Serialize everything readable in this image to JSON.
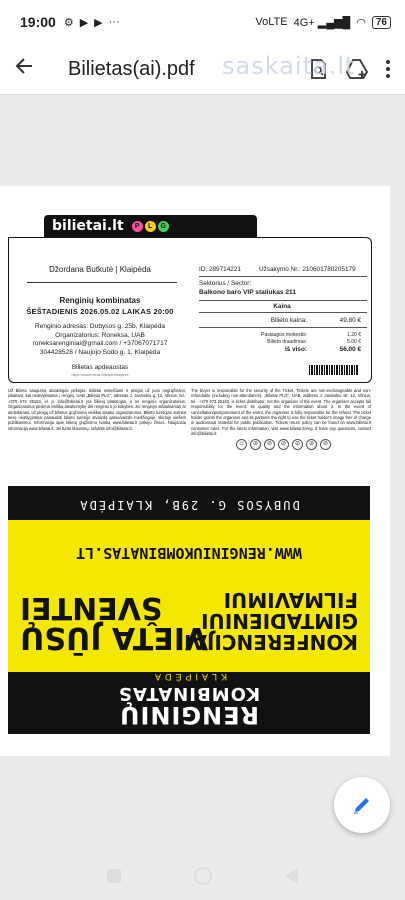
{
  "status_bar": {
    "time": "19:00",
    "battery": "76",
    "network": "4G+",
    "volte": "VoLTE"
  },
  "app_bar": {
    "title": "Bilietas(ai).pdf",
    "watermark": "saskaita.lt"
  },
  "ticket": {
    "logo": "bilietai.lt",
    "plg_letters": [
      "P",
      "L",
      "G"
    ],
    "organizer": "Džordana Butkutė | Klaipėda",
    "event": "Renginių kombinatas",
    "date_line": "ŠEŠTADIENIS 2026.05.02   LAIKAS 20:00",
    "address_lines": [
      "Renginio adresas: Dubysos g. 25b, Klaipėda",
      "Organizatorius: Roneksa, UAB",
      "roneksarenginiai@gmail.com / +37067071717",
      "304428528 / Naujojo Sodo g. 1, Klaipėda"
    ],
    "docs_title": "Bilietas apdeaustas",
    "docs_link": "https://www.bilietai.lt/lit/apie/taisykles",
    "id_line": "ID: 289714221",
    "order_line": "Užsakymo Nr.: 210601780205179",
    "sector_label": "Sektorius / Sector:",
    "seat": "Balkono baro VIP staliukas 211",
    "price_header": "Kaina",
    "rows": [
      {
        "k": "Bilieto kaina:",
        "v": "49.80 €"
      },
      {
        "k": "Paslaugos mokestis:",
        "v": "1.20 €"
      },
      {
        "k": "Bilieto draudimas:",
        "v": "5.00 €"
      },
      {
        "k": "Iš viso:",
        "v": "56.00 €"
      }
    ]
  },
  "terms": {
    "left": "Už Bilieto saugumą atsakingas pirkėjas. Bilietai nekeičiami ir pinigai už juos negrąžinami, įskaitant, kai neatvykstama į renginį. UAB „Bilietai PLG\", adresas J. Jasinskio g. 12, Vilnius, tel.: +370 673 25153, el. p. info@bilietai.lt yra bilietų platintojas, o ne renginio organizatorius. Organizatorius prisiima visišką atsakomybę dėl renginio ir jo kokybės. Jei renginys atšaukiamas ar atidedamas, už pinigų už bilietus grąžinimą visiškai atsako organizatorius. Bilieto turėtojas sutinka teisę neatlygintinai panaudoti bilieto turėtojo atvaizdą garso/vaizdo medžiagoje, skirtoje viešam publikavimui. Informacija apie bilietų grąžinimo tvarką www.bilietai.lt pirkėjo žinios. Naujausia informacija www.bilietai.lt. Jei turite klausimų, rašykite info@bilietai.lt.",
    "right": "The buyer is responsible for the security of the Ticket. Tickets are non-exchangeable and non-refundable (including non-attendance). „Bilietai PLG\", UAB, address J. Jasinskio str. 12, Vilnius, tel.: +370 673 25153, is ticket distributor, not the organiser of the event. The organiser accepts full responsibility for the event, its quality and the information about it. In the event of cancellation/postponement of the event, the organiser is fully responsible for the refund. The ticket holder grants the organiser and its partners the right to use the ticket holder's image free of charge in audiovisual material for public publication. Tickets return policy can be found on www.bilietai.lt consumer rules. For the latest information, visit www.bilietai.lt/eng. If have any questions, contact info@bilietai.lt"
  },
  "poster": {
    "title_1": "RENGINIŲ",
    "title_2": "KOMBINATAS",
    "city": "KLAIPĖDA",
    "left_lines": [
      "KONFERENCIJAI",
      "GIMTADIENIUI",
      "FILMAVIMUI"
    ],
    "right_lines": [
      "VIETA JŪSŲ",
      "ŠVENTEI"
    ],
    "website": "WWW.RENGINIUKOMBINATAS.LT",
    "address": "DUBYSOS G. 29B, KLAIPĖDA"
  }
}
